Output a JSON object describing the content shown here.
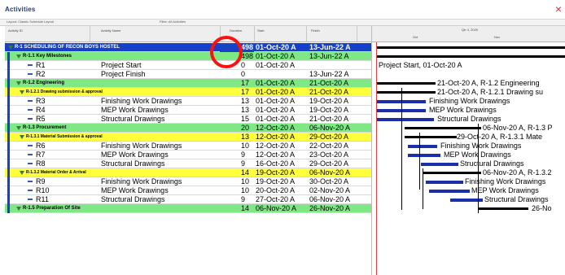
{
  "window": {
    "title": "Activities",
    "close_glyph": "×"
  },
  "grid": {
    "toolbar_labels": [
      "Layout: Classic Schedule Layout",
      "Filter: All Activities"
    ],
    "columns": [
      "Activity ID",
      "Activity Name",
      "Duration",
      "Start",
      "Finish"
    ],
    "rows": [
      {
        "level": "lv1",
        "id": "",
        "name": "R-1  SCHEDULING OF RECON BOYS HOSTEL",
        "duration": "498",
        "start": "01-Oct-20 A",
        "finish": "13-Jun-22 A"
      },
      {
        "level": "lv2",
        "id": "",
        "name": "R-1.1  Key Milestones",
        "duration": "498",
        "start": "01-Oct-20 A",
        "finish": "13-Jun-22 A"
      },
      {
        "level": "act",
        "id": "R1",
        "name": "Project Start",
        "duration": "0",
        "start": "01-Oct-20 A",
        "finish": ""
      },
      {
        "level": "act",
        "id": "R2",
        "name": "Project Finish",
        "duration": "0",
        "start": "",
        "finish": "13-Jun-22 A"
      },
      {
        "level": "lv2",
        "id": "",
        "name": "R-1.2  Engineering",
        "duration": "17",
        "start": "01-Oct-20 A",
        "finish": "21-Oct-20 A"
      },
      {
        "level": "lv3",
        "id": "",
        "name": "R-1.2.1  Drawing submission & approval",
        "duration": "17",
        "start": "01-Oct-20 A",
        "finish": "21-Oct-20 A"
      },
      {
        "level": "act",
        "id": "R3",
        "name": "Finishing Work Drawings",
        "duration": "13",
        "start": "01-Oct-20 A",
        "finish": "19-Oct-20 A"
      },
      {
        "level": "act",
        "id": "R4",
        "name": "MEP Work Drawings",
        "duration": "13",
        "start": "01-Oct-20 A",
        "finish": "19-Oct-20 A"
      },
      {
        "level": "act",
        "id": "R5",
        "name": "Structural Drawings",
        "duration": "15",
        "start": "01-Oct-20 A",
        "finish": "21-Oct-20 A"
      },
      {
        "level": "lv2",
        "id": "",
        "name": "R-1.3  Procurement",
        "duration": "20",
        "start": "12-Oct-20 A",
        "finish": "06-Nov-20 A"
      },
      {
        "level": "lv3",
        "id": "",
        "name": "R-1.3.1  Material Submission & approval",
        "duration": "13",
        "start": "12-Oct-20 A",
        "finish": "29-Oct-20 A"
      },
      {
        "level": "act",
        "id": "R6",
        "name": "Finishing Work Drawings",
        "duration": "10",
        "start": "12-Oct-20 A",
        "finish": "22-Oct-20 A"
      },
      {
        "level": "act",
        "id": "R7",
        "name": "MEP Work Drawings",
        "duration": "9",
        "start": "12-Oct-20 A",
        "finish": "23-Oct-20 A"
      },
      {
        "level": "act",
        "id": "R8",
        "name": "Structural Drawings",
        "duration": "9",
        "start": "16-Oct-20 A",
        "finish": "29-Oct-20 A"
      },
      {
        "level": "lv3",
        "id": "",
        "name": "R-1.3.2  Material Order & Arrival",
        "duration": "14",
        "start": "19-Oct-20 A",
        "finish": "06-Nov-20 A"
      },
      {
        "level": "act",
        "id": "R9",
        "name": "Finishing Work Drawings",
        "duration": "10",
        "start": "19-Oct-20 A",
        "finish": "30-Oct-20 A"
      },
      {
        "level": "act",
        "id": "R10",
        "name": "MEP Work Drawings",
        "duration": "10",
        "start": "20-Oct-20 A",
        "finish": "02-Nov-20 A"
      },
      {
        "level": "act",
        "id": "R11",
        "name": "Structural Drawings",
        "duration": "9",
        "start": "27-Oct-20 A",
        "finish": "06-Nov-20 A"
      },
      {
        "level": "lv2",
        "id": "",
        "name": "R-1.5  Preparation Of Site",
        "duration": "14",
        "start": "06-Nov-20 A",
        "finish": "26-Nov-20 A"
      }
    ]
  },
  "gantt": {
    "header_labels": [
      "Qtr 4, 2020",
      "Oct",
      "Nov"
    ],
    "labels": [
      "Project Start, 01-Oct-20 A",
      "21-Oct-20 A, R-1.2  Engineering",
      "21-Oct-20 A, R-1.2.1  Drawing su",
      "Finishing Work Drawings",
      "MEP Work Drawings",
      "Structural Drawings",
      "06-Nov-20 A, R-1.3  P",
      "29-Oct-20 A, R-1.3.1  Mate",
      "Finishing Work Drawings",
      "MEP Work Drawings",
      "Structural Drawings",
      "06-Nov-20 A, R-1.3.2",
      "Finishing Work Drawings",
      "MEP Work Drawings",
      "Structural Drawings",
      "26-No"
    ]
  },
  "colors": {
    "wbs_level1": "#1540c8",
    "wbs_level2": "#7de884",
    "wbs_level3": "#ffff3c",
    "bar": "#1a2fa8",
    "highlight_ring": "#ff1010"
  }
}
